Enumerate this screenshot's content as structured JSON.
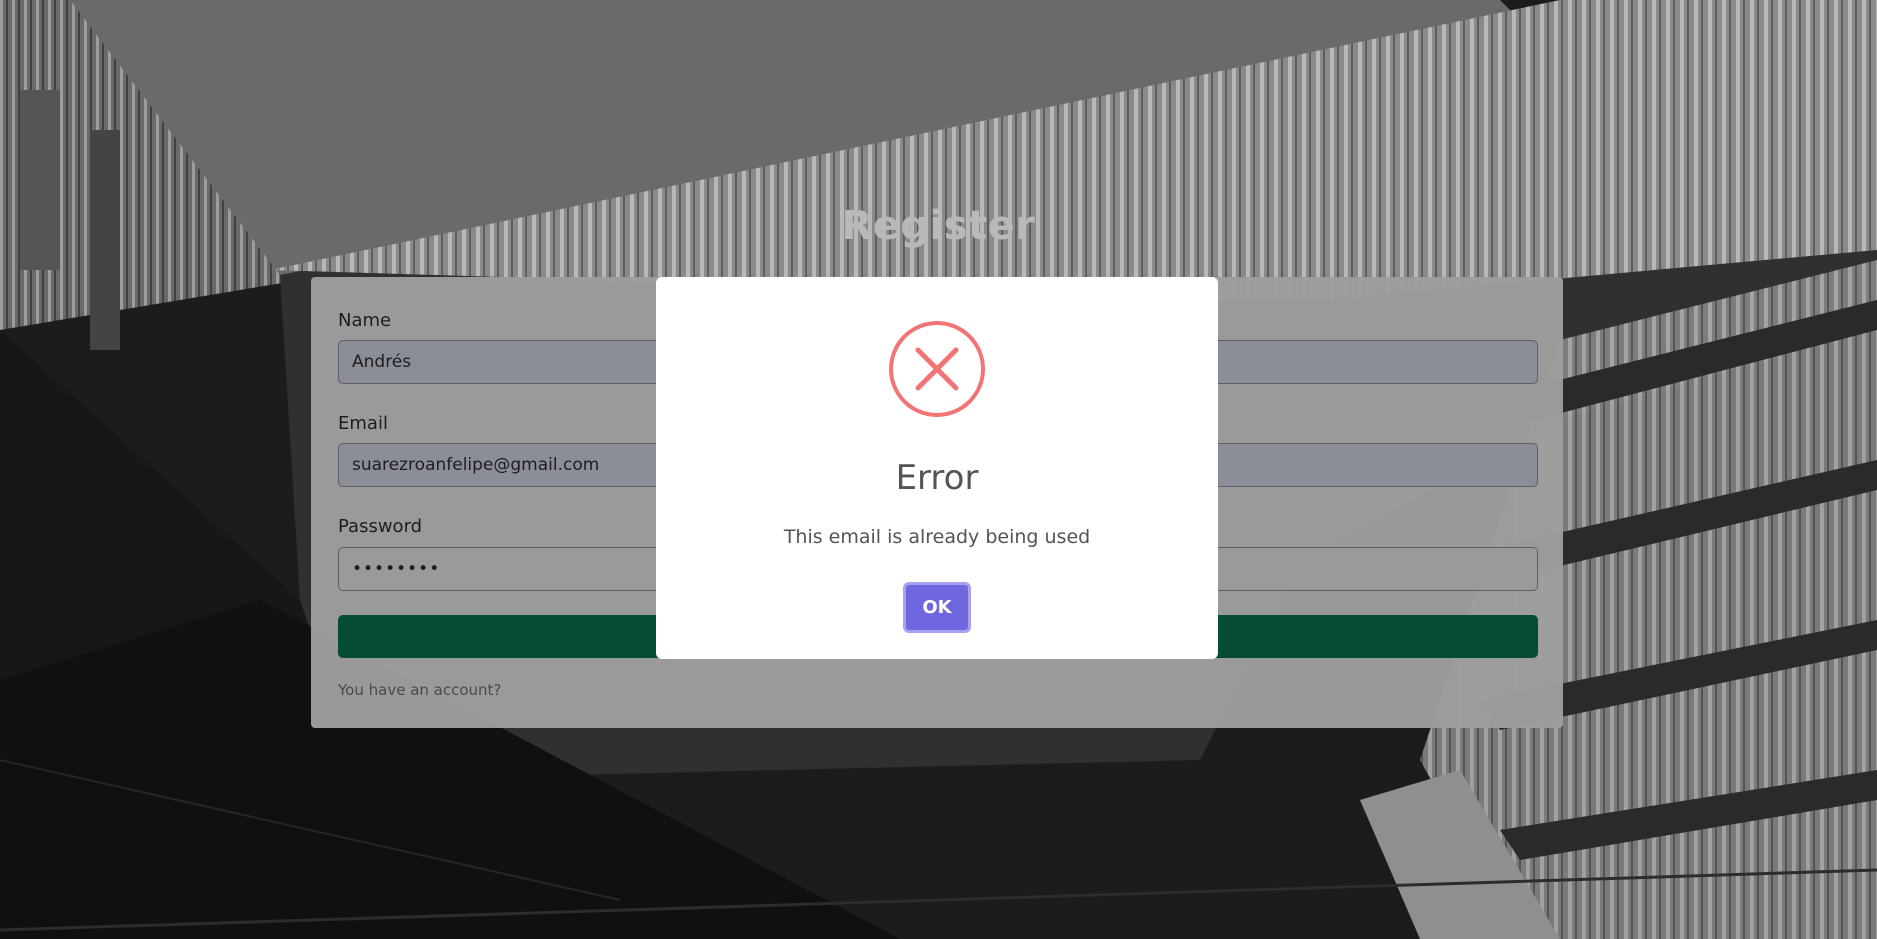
{
  "page": {
    "title": "Register"
  },
  "form": {
    "name_label": "Name",
    "name_value": "Andrés",
    "email_label": "Email",
    "email_value": "suarezroanfelipe@gmail.com",
    "password_label": "Password",
    "password_value": "••••••••",
    "account_link": "You have an account?"
  },
  "alert": {
    "icon": "error-x-icon",
    "title": "Error",
    "message": "This email is already being used",
    "confirm_label": "OK"
  },
  "colors": {
    "submit_button": "#044d33",
    "alert_confirm": "#7066e0",
    "error_icon": "#f27474"
  }
}
